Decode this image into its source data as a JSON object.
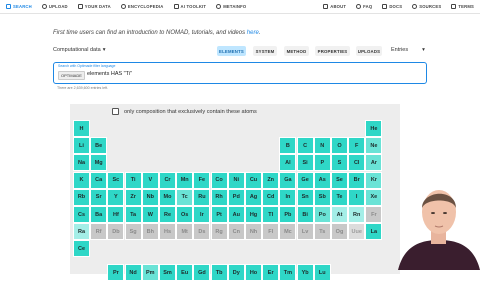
{
  "nav": {
    "left": [
      {
        "label": "SEARCH",
        "icon": "search-icon",
        "active": true
      },
      {
        "label": "UPLOAD",
        "icon": "upload-icon"
      },
      {
        "label": "YOUR DATA",
        "icon": "folder-icon"
      },
      {
        "label": "ENCYCLOPEDIA",
        "icon": "book-icon"
      },
      {
        "label": "AI TOOLKIT",
        "icon": "ai-icon"
      },
      {
        "label": "METAINFO",
        "icon": "info-icon"
      }
    ],
    "right": [
      {
        "label": "ABOUT",
        "icon": "home-icon"
      },
      {
        "label": "FAQ",
        "icon": "faq-icon"
      },
      {
        "label": "DOCS",
        "icon": "docs-icon"
      },
      {
        "label": "SOURCES",
        "icon": "code-icon"
      },
      {
        "label": "TERMS",
        "icon": "terms-icon"
      }
    ]
  },
  "intro": {
    "text": "First time users can find an introduction to NOMAD, tutorials, and videos",
    "link": "here",
    "end": "."
  },
  "controls": {
    "mode": "Computational data",
    "buttons": [
      "ELEMENTS",
      "SYSTEM",
      "METHOD",
      "PROPERTIES",
      "UPLOADS"
    ],
    "active": "ELEMENTS",
    "entries": "Entries"
  },
  "search": {
    "caption": "Search with Optimade filter language",
    "chip": "OPTIMADE",
    "query": "elements HAS \"Ti\""
  },
  "count_line": "There are 2,639,600 entries left.",
  "ptable": {
    "only_composition": "only composition that exclusively contain these atoms",
    "elements": [
      {
        "s": "H",
        "t": "t1"
      },
      {
        "s": "He",
        "t": "t1"
      },
      {
        "s": "Li",
        "t": "t1"
      },
      {
        "s": "Be",
        "t": "t1"
      },
      {
        "s": "B",
        "t": "t1"
      },
      {
        "s": "C",
        "t": "t1"
      },
      {
        "s": "N",
        "t": "t1"
      },
      {
        "s": "O",
        "t": "t1"
      },
      {
        "s": "F",
        "t": "t1"
      },
      {
        "s": "Ne",
        "t": "t2"
      },
      {
        "s": "Na",
        "t": "t1"
      },
      {
        "s": "Mg",
        "t": "t1"
      },
      {
        "s": "Al",
        "t": "t1"
      },
      {
        "s": "Si",
        "t": "t1"
      },
      {
        "s": "P",
        "t": "t1"
      },
      {
        "s": "S",
        "t": "t1"
      },
      {
        "s": "Cl",
        "t": "t1"
      },
      {
        "s": "Ar",
        "t": "t2"
      },
      {
        "s": "K",
        "t": "t1"
      },
      {
        "s": "Ca",
        "t": "t1"
      },
      {
        "s": "Sc",
        "t": "t1"
      },
      {
        "s": "Ti",
        "t": "t1"
      },
      {
        "s": "V",
        "t": "t1"
      },
      {
        "s": "Cr",
        "t": "t1"
      },
      {
        "s": "Mn",
        "t": "t1"
      },
      {
        "s": "Fe",
        "t": "t1"
      },
      {
        "s": "Co",
        "t": "t1"
      },
      {
        "s": "Ni",
        "t": "t1"
      },
      {
        "s": "Cu",
        "t": "t1"
      },
      {
        "s": "Zn",
        "t": "t1"
      },
      {
        "s": "Ga",
        "t": "t1"
      },
      {
        "s": "Ge",
        "t": "t1"
      },
      {
        "s": "As",
        "t": "t1"
      },
      {
        "s": "Se",
        "t": "t1"
      },
      {
        "s": "Br",
        "t": "t1"
      },
      {
        "s": "Kr",
        "t": "t2"
      },
      {
        "s": "Rb",
        "t": "t1"
      },
      {
        "s": "Sr",
        "t": "t1"
      },
      {
        "s": "Y",
        "t": "t1"
      },
      {
        "s": "Zr",
        "t": "t1"
      },
      {
        "s": "Nb",
        "t": "t1"
      },
      {
        "s": "Mo",
        "t": "t1"
      },
      {
        "s": "Tc",
        "t": "t2"
      },
      {
        "s": "Ru",
        "t": "t1"
      },
      {
        "s": "Rh",
        "t": "t1"
      },
      {
        "s": "Pd",
        "t": "t1"
      },
      {
        "s": "Ag",
        "t": "t1"
      },
      {
        "s": "Cd",
        "t": "t1"
      },
      {
        "s": "In",
        "t": "t1"
      },
      {
        "s": "Sn",
        "t": "t1"
      },
      {
        "s": "Sb",
        "t": "t1"
      },
      {
        "s": "Te",
        "t": "t1"
      },
      {
        "s": "I",
        "t": "t1"
      },
      {
        "s": "Xe",
        "t": "t2"
      },
      {
        "s": "Cs",
        "t": "t1"
      },
      {
        "s": "Ba",
        "t": "t1"
      },
      {
        "s": "Hf",
        "t": "t1"
      },
      {
        "s": "Ta",
        "t": "t1"
      },
      {
        "s": "W",
        "t": "t1"
      },
      {
        "s": "Re",
        "t": "t1"
      },
      {
        "s": "Os",
        "t": "t1"
      },
      {
        "s": "Ir",
        "t": "t1"
      },
      {
        "s": "Pt",
        "t": "t1"
      },
      {
        "s": "Au",
        "t": "t1"
      },
      {
        "s": "Hg",
        "t": "t1"
      },
      {
        "s": "Tl",
        "t": "t1"
      },
      {
        "s": "Pb",
        "t": "t1"
      },
      {
        "s": "Bi",
        "t": "t1"
      },
      {
        "s": "Po",
        "t": "t2"
      },
      {
        "s": "At",
        "t": "t3"
      },
      {
        "s": "Rn",
        "t": "t3"
      },
      {
        "s": "Fr",
        "t": "g1"
      },
      {
        "s": "Ra",
        "t": "t3"
      },
      {
        "s": "Rf",
        "t": "g1"
      },
      {
        "s": "Db",
        "t": "g1"
      },
      {
        "s": "Sg",
        "t": "g1"
      },
      {
        "s": "Bh",
        "t": "g1"
      },
      {
        "s": "Hs",
        "t": "g1"
      },
      {
        "s": "Mt",
        "t": "g1"
      },
      {
        "s": "Ds",
        "t": "g1"
      },
      {
        "s": "Rg",
        "t": "g1"
      },
      {
        "s": "Cn",
        "t": "g1"
      },
      {
        "s": "Nh",
        "t": "g1"
      },
      {
        "s": "Fl",
        "t": "g1"
      },
      {
        "s": "Mc",
        "t": "g1"
      },
      {
        "s": "Lv",
        "t": "g1"
      },
      {
        "s": "Ts",
        "t": "g1"
      },
      {
        "s": "Og",
        "t": "g1"
      },
      {
        "s": "Uue",
        "t": "g2"
      },
      {
        "s": "La",
        "t": "t1"
      },
      {
        "s": "Ce",
        "t": "t1"
      },
      {
        "s": "Pr",
        "t": "t1"
      },
      {
        "s": "Nd",
        "t": "t1"
      },
      {
        "s": "Pm",
        "t": "t2"
      },
      {
        "s": "Sm",
        "t": "t1"
      },
      {
        "s": "Eu",
        "t": "t1"
      },
      {
        "s": "Gd",
        "t": "t1"
      },
      {
        "s": "Tb",
        "t": "t1"
      },
      {
        "s": "Dy",
        "t": "t1"
      },
      {
        "s": "Ho",
        "t": "t1"
      },
      {
        "s": "Er",
        "t": "t1"
      },
      {
        "s": "Tm",
        "t": "t1"
      },
      {
        "s": "Yb",
        "t": "t1"
      },
      {
        "s": "Lu",
        "t": "t1"
      }
    ]
  },
  "colors": {
    "accent": "#1e88e5",
    "element_high": "#2fd7c7",
    "element_mid": "#6ae3d6",
    "element_low": "#a4eee7",
    "element_none": "#c8c8c8"
  }
}
